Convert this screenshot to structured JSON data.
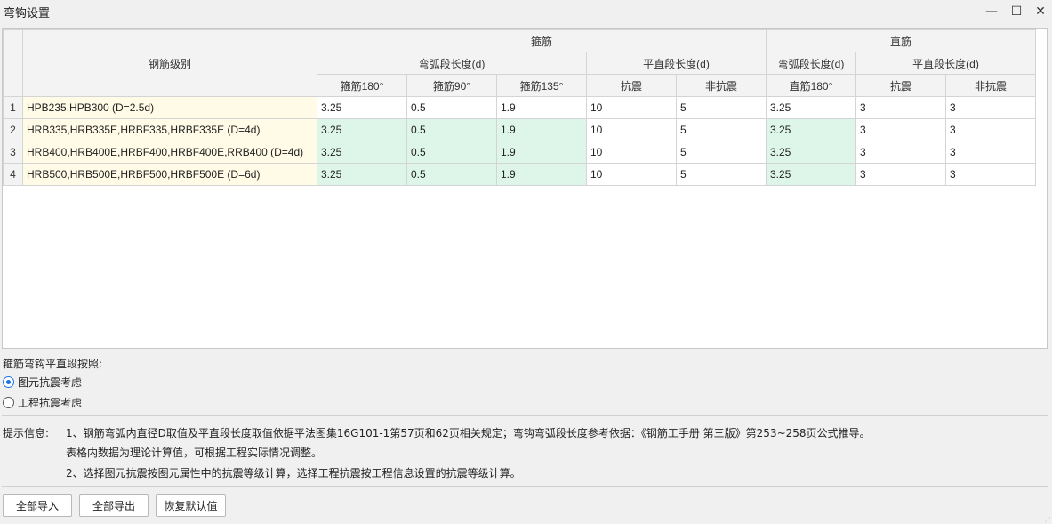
{
  "window": {
    "title": "弯钩设置",
    "minimize_glyph": "—",
    "maximize_glyph": "☐",
    "close_glyph": "✕"
  },
  "table": {
    "header": {
      "grade_col": "钢筋级别",
      "stirrup_group": "箍筋",
      "straight_group": "直筋",
      "stirrup_arc": "弯弧段长度(d)",
      "stirrup_flat": "平直段长度(d)",
      "straight_arc": "弯弧段长度(d)",
      "straight_flat": "平直段长度(d)",
      "cols": [
        "箍筋180°",
        "箍筋90°",
        "箍筋135°",
        "抗震",
        "非抗震",
        "直筋180°",
        "抗震",
        "非抗震"
      ]
    },
    "rows": [
      {
        "num": "1",
        "grade": "HPB235,HPB300 (D=2.5d)",
        "values": [
          "3.25",
          "0.5",
          "1.9",
          "10",
          "5",
          "3.25",
          "3",
          "3"
        ]
      },
      {
        "num": "2",
        "grade": "HRB335,HRB335E,HRBF335,HRBF335E (D=4d)",
        "values": [
          "3.25",
          "0.5",
          "1.9",
          "10",
          "5",
          "3.25",
          "3",
          "3"
        ]
      },
      {
        "num": "3",
        "grade": "HRB400,HRB400E,HRBF400,HRBF400E,RRB400 (D=4d)",
        "values": [
          "3.25",
          "0.5",
          "1.9",
          "10",
          "5",
          "3.25",
          "3",
          "3"
        ]
      },
      {
        "num": "4",
        "grade": "HRB500,HRB500E,HRBF500,HRBF500E (D=6d)",
        "values": [
          "3.25",
          "0.5",
          "1.9",
          "10",
          "5",
          "3.25",
          "3",
          "3"
        ]
      }
    ]
  },
  "options": {
    "label": "箍筋弯钩平直段按照:",
    "radio1": "图元抗震考虑",
    "radio2": "工程抗震考虑",
    "selected": "图元抗震考虑"
  },
  "hint": {
    "label": "提示信息:",
    "line1": "1、钢筋弯弧内直径D取值及平直段长度取值依据平法图集16G101-1第57页和62页相关规定；弯钩弯弧段长度参考依据：《钢筋工手册  第三版》第253~258页公式推导。",
    "line2": "表格内数据为理论计算值，可根据工程实际情况调整。",
    "line3": "2、选择图元抗震按图元属性中的抗震等级计算，选择工程抗震按工程信息设置的抗震等级计算。"
  },
  "buttons": {
    "import_all": "全部导入",
    "export_all": "全部导出",
    "restore_default": "恢复默认值"
  },
  "colors": {
    "grade_cell_bg": "#fffbe6",
    "edited_cell_bg": "#def6ea",
    "radio_accent": "#1a73e8"
  }
}
